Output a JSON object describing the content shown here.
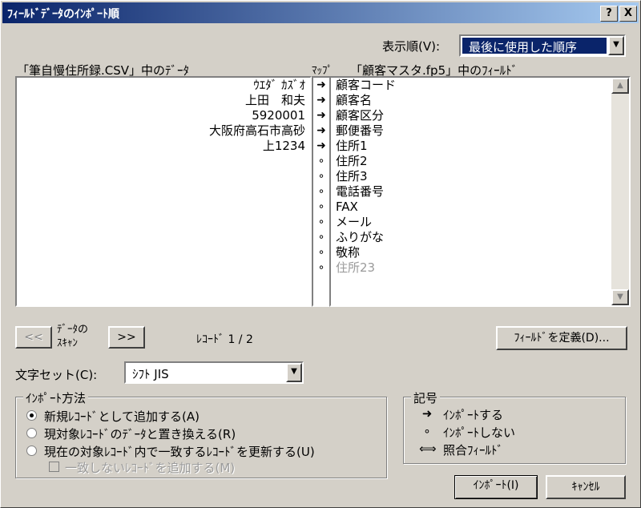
{
  "window": {
    "title": "ﾌｨｰﾙﾄﾞﾃﾞｰﾀのｲﾝﾎﾟｰﾄ順",
    "help_btn": "?",
    "close_btn": "X"
  },
  "order": {
    "label": "表示順(V):",
    "value": "最後に使用した順序"
  },
  "source": {
    "header": "「筆自慢住所録.CSV」中のﾃﾞｰﾀ",
    "rows": [
      "ｳｴﾀﾞ ｶｽﾞｵ",
      "上田　和夫",
      "5920001",
      "大阪府高石市高砂",
      "上1234",
      "",
      "",
      "",
      "",
      "",
      "",
      "",
      ""
    ]
  },
  "map": {
    "header": "ﾏｯﾌﾟ",
    "symbols": [
      "➜",
      "➜",
      "➜",
      "➜",
      "➜",
      "∘",
      "∘",
      "∘",
      "∘",
      "∘",
      "∘",
      "∘",
      "∘"
    ]
  },
  "target": {
    "header": "「顧客マスタ.fp5」中のﾌｨｰﾙﾄﾞ",
    "fields": [
      "顧客コード",
      "顧客名",
      "顧客区分",
      "郵便番号",
      "住所1",
      "住所2",
      "住所3",
      "電話番号",
      "FAX",
      "メール",
      "ふりがな",
      "敬称",
      "住所23"
    ]
  },
  "nav": {
    "prev": "<<",
    "next": ">>",
    "scan_label_1": "ﾃﾞｰﾀの",
    "scan_label_2": "ｽｷｬﾝ",
    "record": "ﾚｺｰﾄﾞ 1 / 2"
  },
  "define_fields_btn": "ﾌｨｰﾙﾄﾞを定義(D)...",
  "charset": {
    "label": "文字セット(C):",
    "value": "ｼﾌﾄ JIS"
  },
  "import_method": {
    "title": "ｲﾝﾎﾟｰﾄ方法",
    "options": [
      "新規ﾚｺｰﾄﾞとして追加する(A)",
      "現対象ﾚｺｰﾄﾞのﾃﾞｰﾀと置き換える(R)",
      "現在の対象ﾚｺｰﾄﾞ内で一致するﾚｺｰﾄﾞを更新する(U)"
    ],
    "sub_option": "一致しないﾚｺｰﾄﾞを追加する(M)"
  },
  "legend": {
    "title": "記号",
    "items": [
      {
        "symbol": "➜",
        "text": "ｲﾝﾎﾟｰﾄする"
      },
      {
        "symbol": "∘",
        "text": "ｲﾝﾎﾟｰﾄしない"
      },
      {
        "symbol": "⟺",
        "text": "照合ﾌｨｰﾙﾄﾞ"
      }
    ]
  },
  "buttons": {
    "import": "ｲﾝﾎﾟｰﾄ(I)",
    "cancel": "ｷｬﾝｾﾙ"
  }
}
